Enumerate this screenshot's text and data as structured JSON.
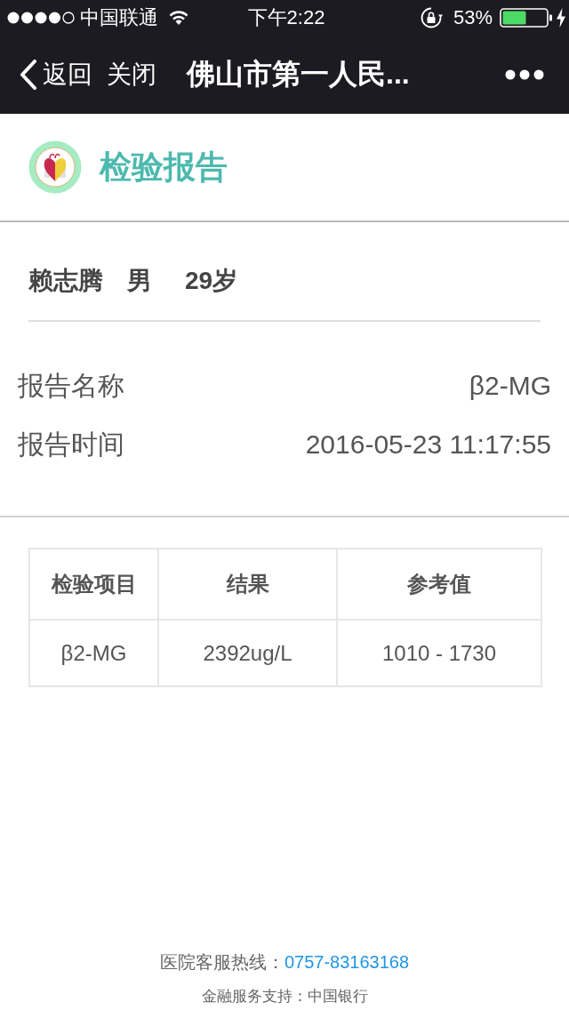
{
  "status_bar": {
    "carrier": "中国联通",
    "time": "下午2:22",
    "battery": "53%"
  },
  "nav_bar": {
    "back": "返回",
    "close": "关闭",
    "title": "佛山市第一人民..."
  },
  "header": {
    "title": "检验报告"
  },
  "patient": {
    "name": "赖志腾",
    "gender": "男",
    "age": "29岁"
  },
  "fields": [
    {
      "label": "报告名称",
      "value": "β2-MG"
    },
    {
      "label": "报告时间",
      "value": "2016-05-23 11:17:55"
    }
  ],
  "table": {
    "columns": [
      "检验项目",
      "结果",
      "参考值"
    ],
    "rows": [
      [
        "β2-MG",
        "2392ug/L",
        "1010 - 1730"
      ]
    ]
  },
  "footer": {
    "hotline_label": "医院客服热线：",
    "hotline": "0757-83163168",
    "support": "金融服务支持：中国银行"
  }
}
